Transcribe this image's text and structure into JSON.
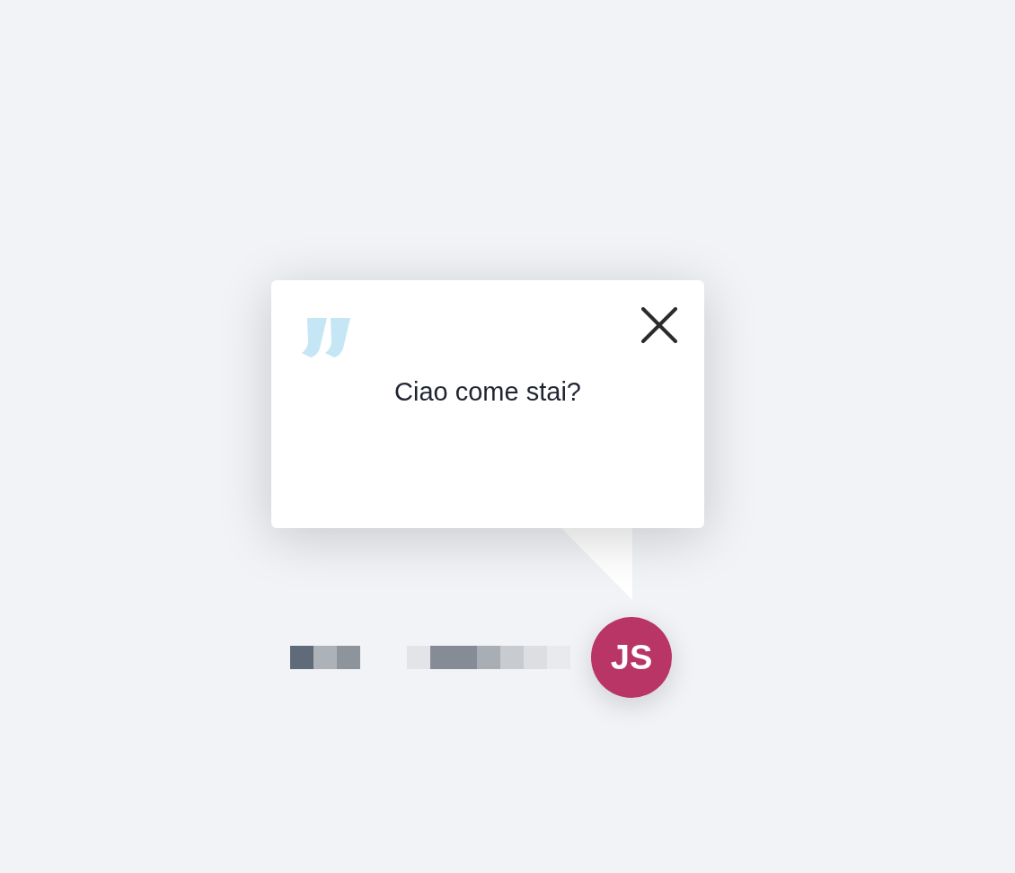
{
  "message": {
    "text": "Ciao come stai?"
  },
  "avatar": {
    "initials": "JS"
  }
}
